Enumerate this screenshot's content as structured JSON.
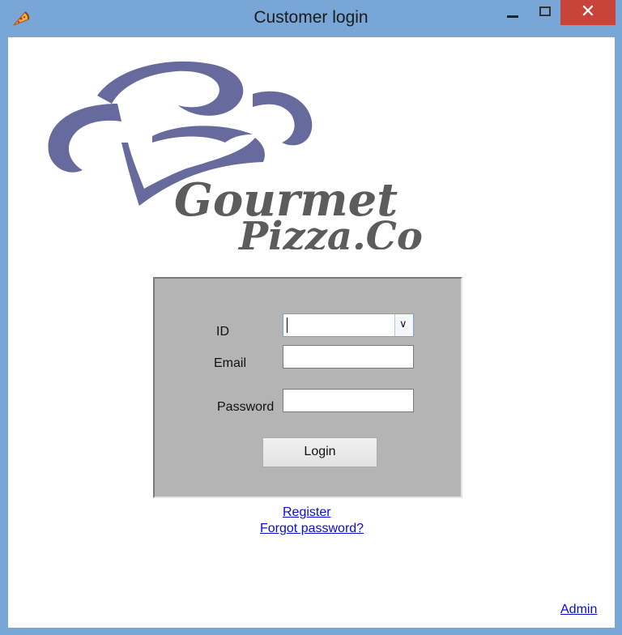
{
  "window": {
    "title": "Customer login",
    "app_icon": "pizza-icon",
    "controls": {
      "minimize_icon": "minimize-icon",
      "maximize_icon": "maximize-icon",
      "close_icon": "close-icon",
      "close_glyph": "✕"
    },
    "frame_color": "#78a6d6",
    "close_color": "#c8443b"
  },
  "logo": {
    "line1": "Gourmet",
    "line2": "Pizza.Co",
    "hat_color": "#676a9c",
    "text_color": "#5c5c5c"
  },
  "form": {
    "id_label": "ID",
    "id_value": "",
    "email_label": "Email",
    "email_value": "",
    "password_label": "Password",
    "password_value": "",
    "login_label": "Login",
    "panel_color": "#b4b4b4"
  },
  "links": {
    "register": "Register",
    "forgot": "Forgot password?",
    "admin": "Admin",
    "color": "#0b0bd8"
  }
}
